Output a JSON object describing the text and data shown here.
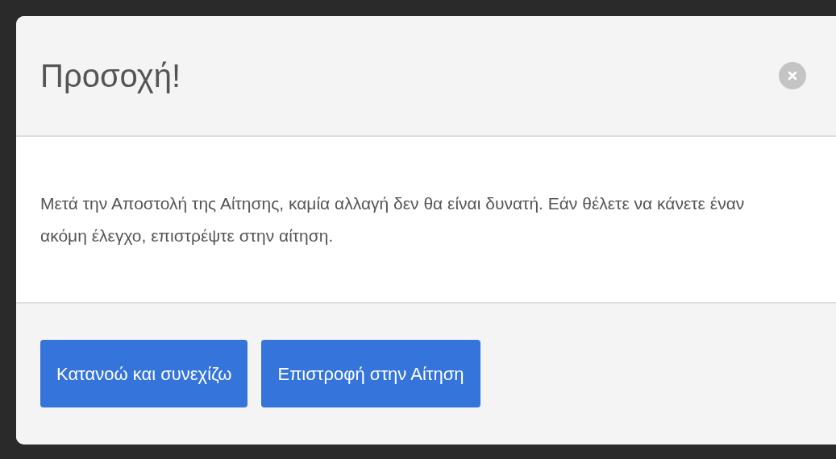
{
  "dialog": {
    "title": "Προσοχή!",
    "message": "Μετά την Αποστολή της Αίτησης, καμία αλλαγή δεν θα είναι δυνατή. Εάν θέλετε να κάνετε έναν ακόμη έλεγχο, επιστρέψτε στην αίτηση.",
    "buttons": [
      "Κατανοώ και συνεχίζω",
      "Επιστροφή στην Αίτηση"
    ]
  }
}
